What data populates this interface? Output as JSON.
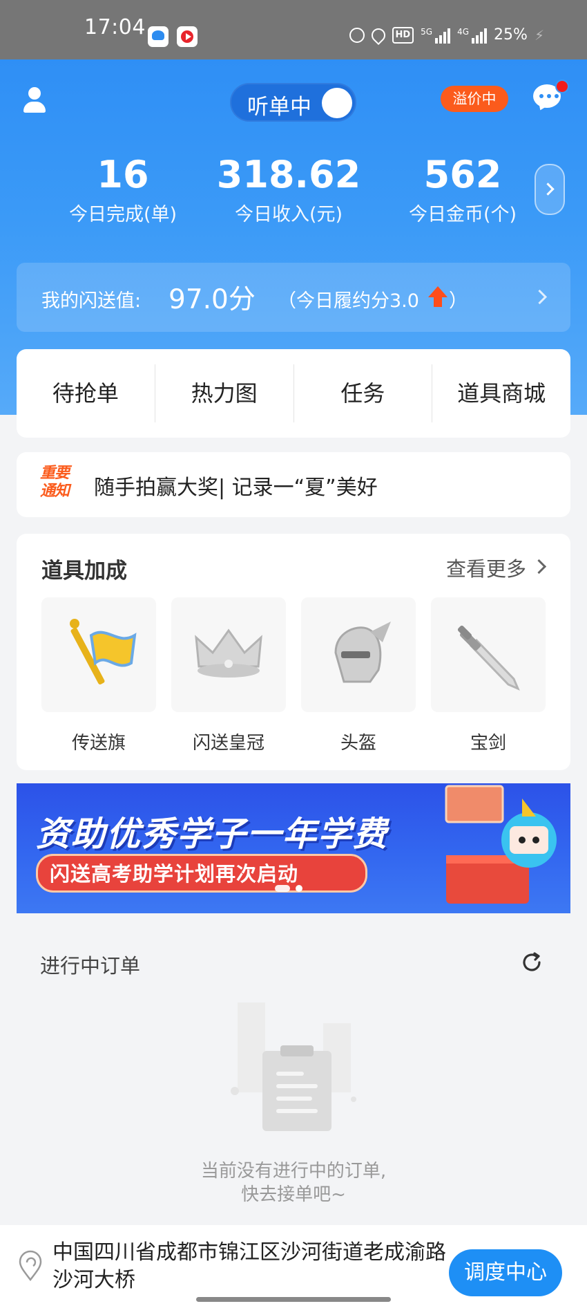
{
  "status_bar": {
    "time": "17:04",
    "hd": "HD",
    "net1": "5G",
    "net2": "4G",
    "battery": "25%"
  },
  "header": {
    "listen_toggle": "听单中",
    "listen_on": true,
    "premium_badge": "溢价中",
    "has_new_message": true
  },
  "stats": [
    {
      "value": "16",
      "label": "今日完成(单)"
    },
    {
      "value": "318.62",
      "label": "今日收入(元)"
    },
    {
      "value": "562",
      "label": "今日金币(个)"
    }
  ],
  "score": {
    "label": "我的闪送值:",
    "value": "97.0分",
    "sub": "（今日履约分3.0",
    "close": "）"
  },
  "quick_menu": [
    "待抢单",
    "热力图",
    "任务",
    "道具商城"
  ],
  "notice": {
    "tag_line1": "重要",
    "tag_line2": "通知",
    "text": "随手拍赢大奖| 记录一“夏”美好"
  },
  "props": {
    "title": "道具加成",
    "more": "查看更多",
    "items": [
      {
        "name": "传送旗",
        "icon": "flag-icon"
      },
      {
        "name": "闪送皇冠",
        "icon": "crown-icon"
      },
      {
        "name": "头盔",
        "icon": "helmet-icon"
      },
      {
        "name": "宝剑",
        "icon": "sword-icon"
      }
    ]
  },
  "banner": {
    "headline": "资助优秀学子一年学费",
    "subline": "闪送高考助学计划再次启动",
    "slide_count": 2,
    "active_slide": 1
  },
  "orders": {
    "title": "进行中订单",
    "empty_line1": "当前没有进行中的订单,",
    "empty_line2": "快去接单吧~"
  },
  "bottom": {
    "address": "中国四川省成都市锦江区沙河街道老成渝路沙河大桥",
    "dispatch": "调度中心"
  },
  "colors": {
    "primary_blue": "#2f8ff5",
    "accent_orange": "#fb5b1c",
    "banner_blue": "#3367f0"
  }
}
